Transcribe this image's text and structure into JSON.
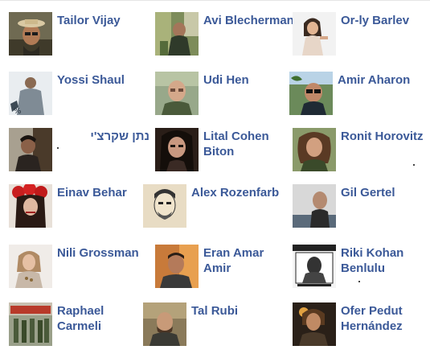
{
  "friends": [
    {
      "name": "Tailor Vijay",
      "icon": "profile-photo-icon"
    },
    {
      "name": "Avi Blecherman",
      "icon": "profile-photo-icon"
    },
    {
      "name": "Or-ly Barlev",
      "icon": "profile-photo-icon"
    },
    {
      "name": "Yossi Shaul",
      "icon": "profile-photo-icon"
    },
    {
      "name": "Udi Hen",
      "icon": "profile-photo-icon"
    },
    {
      "name": "Amir Aharon",
      "icon": "profile-photo-icon"
    },
    {
      "name": "נתן שקרצ'י",
      "icon": "profile-photo-icon"
    },
    {
      "name": "Lital Cohen Biton",
      "icon": "profile-photo-icon"
    },
    {
      "name": "Ronit Horovitz",
      "icon": "profile-photo-icon"
    },
    {
      "name": "Einav Behar",
      "icon": "profile-photo-icon"
    },
    {
      "name": "Alex Rozenfarb",
      "icon": "profile-photo-icon"
    },
    {
      "name": "Gil Gertel",
      "icon": "profile-photo-icon"
    },
    {
      "name": "Nili Grossman",
      "icon": "profile-photo-icon"
    },
    {
      "name": "Eran Amar Amir",
      "icon": "profile-photo-icon"
    },
    {
      "name": "Riki Kohan Benlulu",
      "icon": "profile-photo-icon"
    },
    {
      "name": "Raphael Carmeli",
      "icon": "profile-photo-icon"
    },
    {
      "name": "Tal Rubi",
      "icon": "profile-photo-icon"
    },
    {
      "name": "Ofer Pedut Hernández",
      "icon": "profile-photo-icon"
    }
  ],
  "colors": {
    "link": "#3b5998",
    "divider": "#e5e5e5",
    "background": "#ffffff"
  }
}
